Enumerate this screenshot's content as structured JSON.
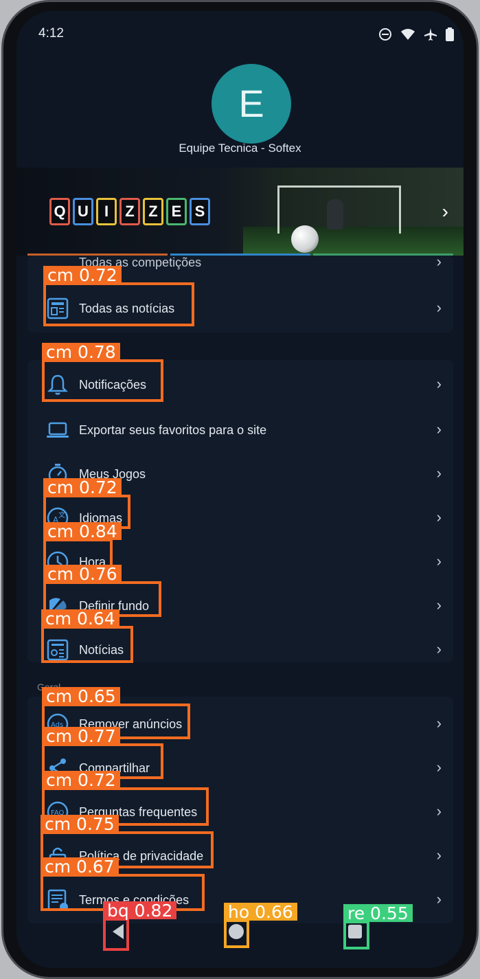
{
  "status_bar": {
    "time": "4:12",
    "icons": [
      "dnd-icon",
      "wifi-icon",
      "airplane-icon",
      "battery-icon"
    ]
  },
  "account": {
    "avatar_letter": "E",
    "name": "Equipe Tecnica - Softex",
    "avatar_color": "#1c8e94"
  },
  "banner": {
    "letters": [
      "Q",
      "U",
      "I",
      "Z",
      "Z",
      "E",
      "S"
    ],
    "chevron": "›"
  },
  "sections": {
    "geral": "Geral"
  },
  "menu": {
    "todas_competicoes": "Todas as competições",
    "todas_noticias": "Todas as notícias",
    "notificacoes": "Notificações",
    "exportar": "Exportar seus favoritos para o site",
    "meus_jogos": "Meus Jogos",
    "idiomas": "Idiomas",
    "hora": "Hora",
    "definir_fundo": "Definir fundo",
    "noticias": "Notícias",
    "remover_anuncios": "Remover anúncios",
    "compartilhar": "Compartilhar",
    "perguntas": "Perguntas frequentes",
    "politica": "Política de privacidade",
    "termos": "Termos e condições"
  },
  "detections": {
    "todas_noticias": "cm 0.72",
    "notificacoes": "cm 0.78",
    "idiomas": "cm 0.72",
    "hora": "cm 0.84",
    "definir_fundo": "cm 0.76",
    "noticias": "cm 0.64",
    "remover_anuncios": "cm 0.65",
    "compartilhar": "cm 0.77",
    "perguntas": "cm 0.72",
    "politica": "cm 0.75",
    "termos": "cm 0.67",
    "back": "bq 0.82",
    "home": "ho 0.66",
    "recent": "re 0.55"
  },
  "colors": {
    "accent": "#4da0e8",
    "detection": "#f36c21",
    "back": "#e94141",
    "home": "#f5a623",
    "recent": "#3ccf7e"
  }
}
